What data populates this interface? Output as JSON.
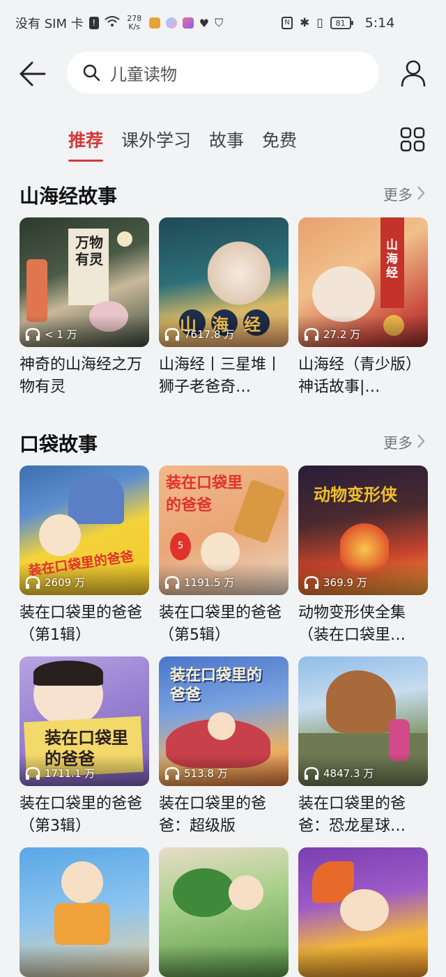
{
  "status_bar": {
    "carrier": "没有 SIM 卡",
    "net_speed_value": "278",
    "net_speed_unit": "K/s",
    "battery": "81",
    "time": "5:14"
  },
  "search": {
    "query": "儿童读物"
  },
  "tabs": [
    {
      "label": "推荐",
      "active": true
    },
    {
      "label": "课外学习",
      "active": false
    },
    {
      "label": "故事",
      "active": false
    },
    {
      "label": "免费",
      "active": false
    }
  ],
  "sections": [
    {
      "title": "山海经故事",
      "more": "更多",
      "items": [
        {
          "title": "神奇的山海经之万物有灵",
          "plays": "< 1 万",
          "cover_text": "万物有灵"
        },
        {
          "title": "山海经丨三星堆丨狮子老爸奇…",
          "plays": "7617.8 万",
          "cover_text": "山海经"
        },
        {
          "title": "山海经（青少版）神话故事|…",
          "plays": "27.2 万",
          "cover_text": "山海经"
        }
      ]
    },
    {
      "title": "口袋故事",
      "more": "更多",
      "items": [
        {
          "title": "装在口袋里的爸爸（第1辑）",
          "plays": "2609 万",
          "cover_text": "装在口袋里的爸爸"
        },
        {
          "title": "装在口袋里的爸爸（第5辑）",
          "plays": "1191.5 万",
          "cover_text": "装在口袋里的爸爸"
        },
        {
          "title": "动物变形侠全集（装在口袋里…",
          "plays": "369.9 万",
          "cover_text": "动物变形侠"
        },
        {
          "title": "装在口袋里的爸爸（第3辑）",
          "plays": "1711.1 万",
          "cover_text": "装在口袋里的爸爸"
        },
        {
          "title": "装在口袋里的爸爸：超级版",
          "plays": "513.8 万",
          "cover_text": "装在口袋里的爸爸"
        },
        {
          "title": "装在口袋里的爸爸：恐龙星球…",
          "plays": "4847.3 万",
          "cover_text": ""
        }
      ]
    }
  ]
}
